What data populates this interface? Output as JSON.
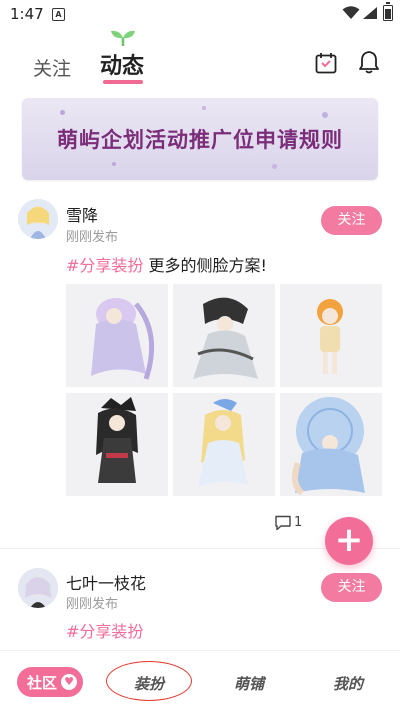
{
  "status_bar": {
    "time": "1:47",
    "notif_icon": "A"
  },
  "header": {
    "tabs": [
      {
        "label": "关注",
        "active": false
      },
      {
        "label": "动态",
        "active": true
      }
    ],
    "icons": [
      "calendar-icon",
      "bell-icon"
    ]
  },
  "banner": {
    "title": "萌屿企划活动推广位申请规则"
  },
  "posts": [
    {
      "username": "雪降",
      "time": "刚刚发布",
      "follow_label": "关注",
      "tag": "#分享装扮",
      "text": " 更多的侧脸方案!",
      "images": [
        "outfit-1",
        "outfit-2",
        "outfit-3",
        "outfit-4",
        "outfit-5",
        "outfit-6"
      ],
      "comment_count": "1"
    },
    {
      "username": "七叶一枝花",
      "time": "刚刚发布",
      "follow_label": "关注",
      "tag": "#分享装扮"
    }
  ],
  "fab": {
    "label": "+"
  },
  "bottom_nav": [
    {
      "label": "社区",
      "active": true
    },
    {
      "label": "装扮",
      "active": false,
      "circled": true
    },
    {
      "label": "萌铺",
      "active": false
    },
    {
      "label": "我的",
      "active": false
    }
  ],
  "colors": {
    "accent": "#f26d97",
    "banner_text": "#7b2d7a",
    "annotation": "#e23a2e"
  }
}
